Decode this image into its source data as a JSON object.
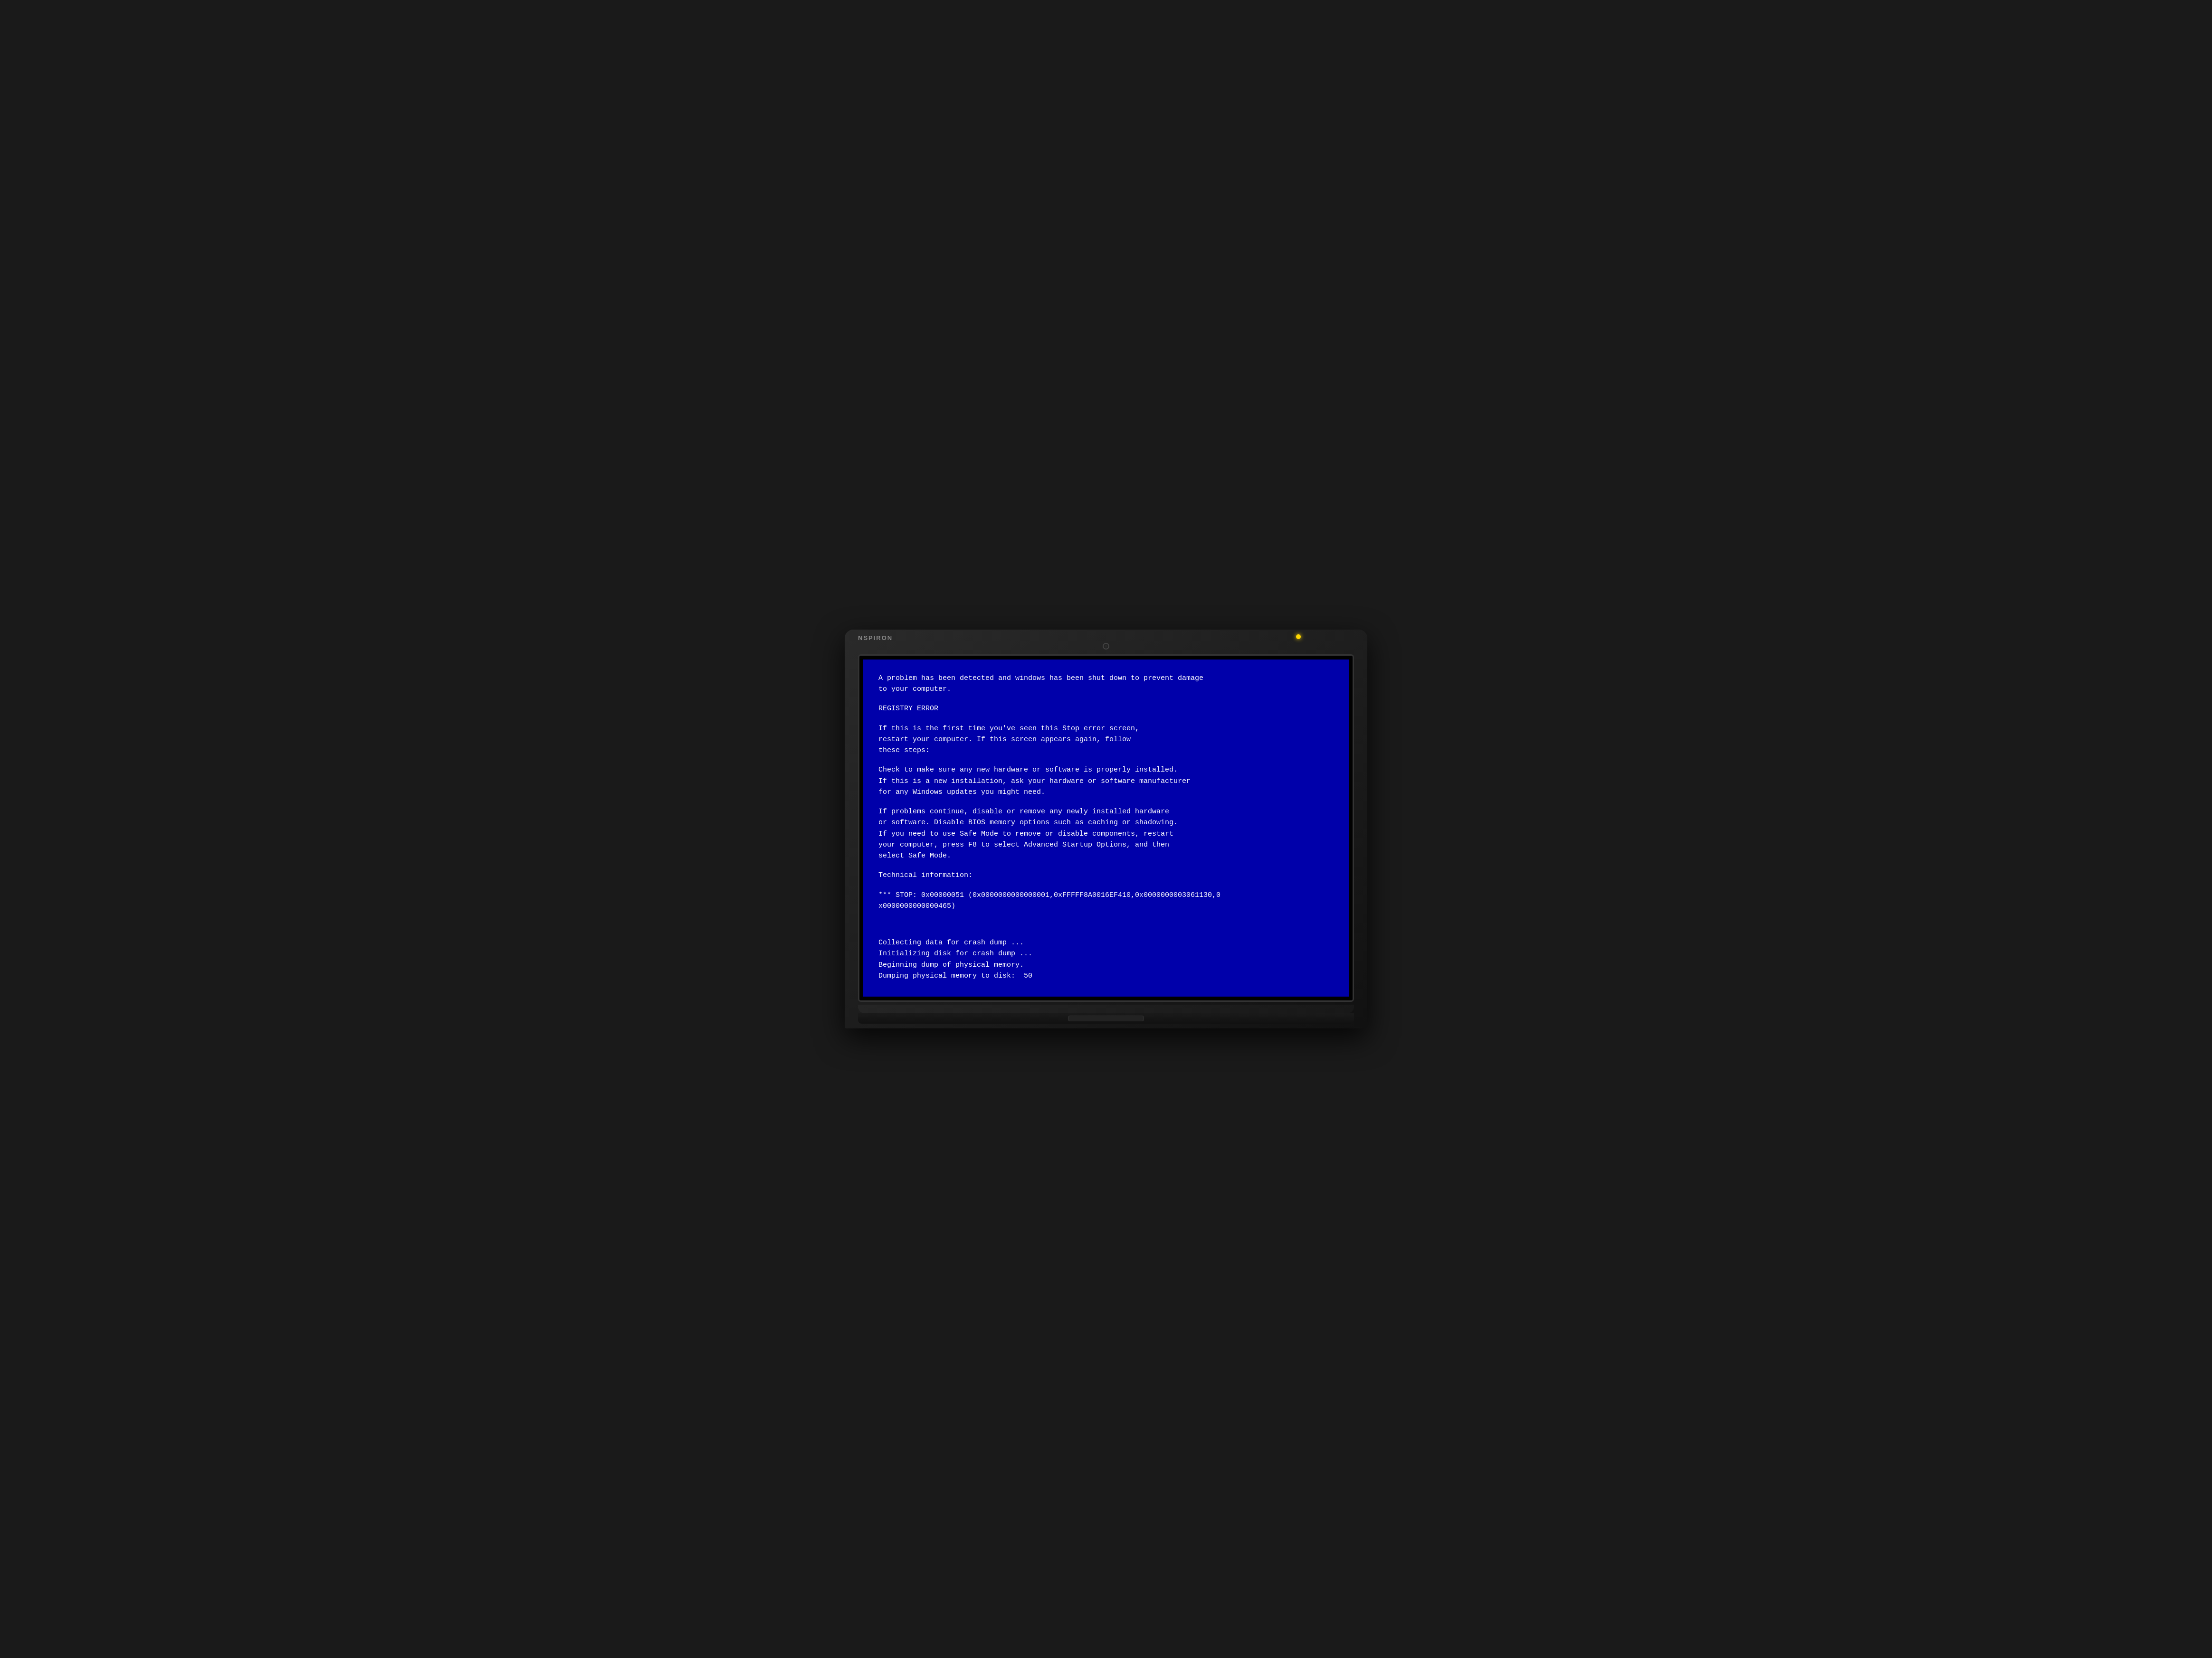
{
  "laptop": {
    "brand": "NSPIRON",
    "indicator_color": "#ffd700"
  },
  "bsod": {
    "background_color": "#0000AA",
    "text_color": "#ffffff",
    "lines": [
      "A problem has been detected and windows has been shut down to prevent damage",
      "to your computer.",
      "",
      "REGISTRY_ERROR",
      "",
      "If this is the first time you've seen this Stop error screen,",
      "restart your computer. If this screen appears again, follow",
      "these steps:",
      "",
      "Check to make sure any new hardware or software is properly installed.",
      "If this is a new installation, ask your hardware or software manufacturer",
      "for any Windows updates you might need.",
      "",
      "If problems continue, disable or remove any newly installed hardware",
      "or software. Disable BIOS memory options such as caching or shadowing.",
      "If you need to use Safe Mode to remove or disable components, restart",
      "your computer, press F8 to select Advanced Startup Options, and then",
      "select Safe Mode.",
      "",
      "Technical information:",
      "",
      "*** STOP: 0x00000051 (0x0000000000000001,0xFFFFF8A0016EF410,0x0000000003061130,0",
      "x0000000000000465)",
      "",
      "",
      "",
      "Collecting data for crash dump ...",
      "Initializing disk for crash dump ...",
      "Beginning dump of physical memory.",
      "Dumping physical memory to disk:  50"
    ]
  }
}
